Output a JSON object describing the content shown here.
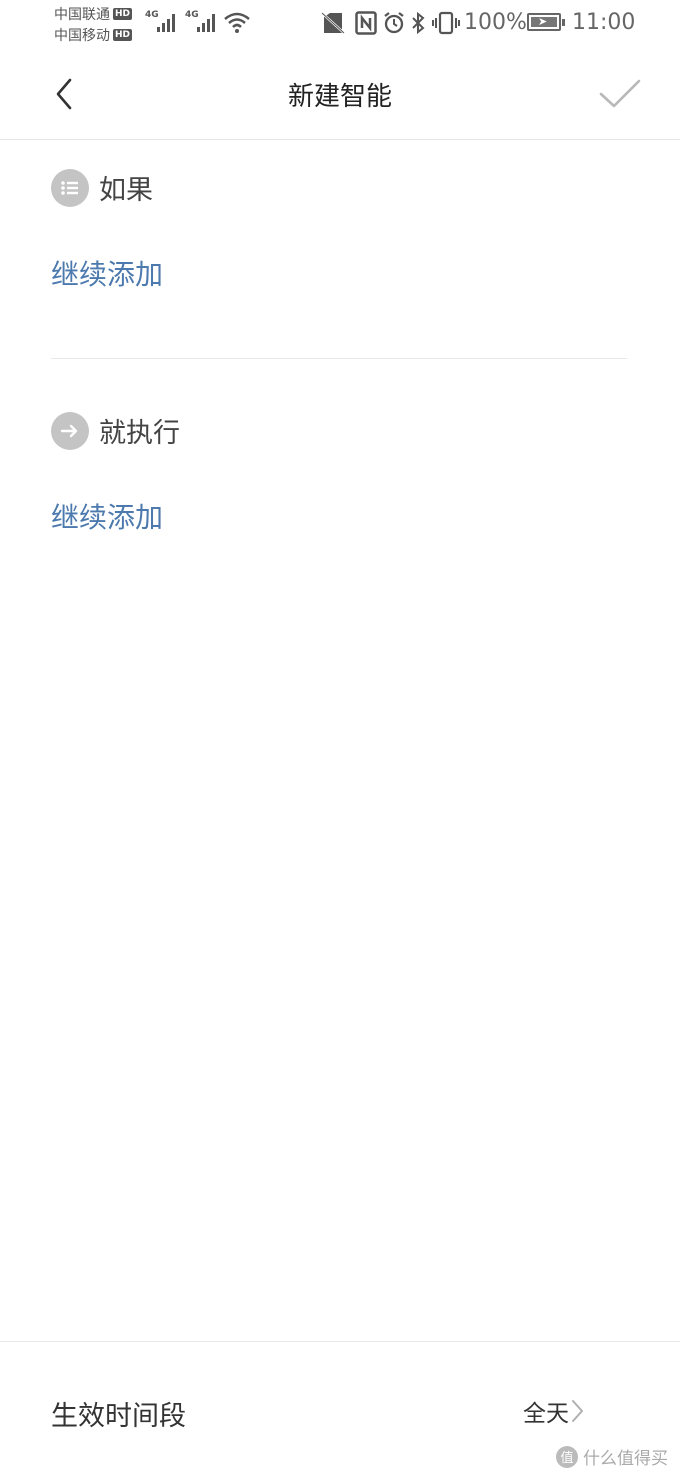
{
  "status_bar": {
    "carrier_1": "中国联通",
    "carrier_2": "中国移动",
    "hd": "HD",
    "network_1": "4G",
    "network_2": "4G",
    "battery_percent": "100%",
    "time": "11:00",
    "icons": [
      "signal-icon",
      "wifi-icon",
      "no-sim-icon",
      "nfc-icon",
      "alarm-icon",
      "bluetooth-icon",
      "vibrate-icon",
      "battery-charging-icon"
    ]
  },
  "header": {
    "title": "新建智能",
    "back_icon": "chevron-left-icon",
    "confirm_icon": "checkmark-icon"
  },
  "if_section": {
    "title": "如果",
    "icon": "list-icon",
    "add_label": "继续添加"
  },
  "then_section": {
    "title": "就执行",
    "icon": "arrow-right-icon",
    "add_label": "继续添加"
  },
  "footer": {
    "label": "生效时间段",
    "value": "全天",
    "chevron_icon": "chevron-right-icon"
  },
  "watermark": {
    "text": "什么值得买",
    "logo_char": "值"
  },
  "colors": {
    "link": "#4d7aae",
    "icon_circle": "#c4c4c4",
    "divider": "#e8e8e8"
  }
}
